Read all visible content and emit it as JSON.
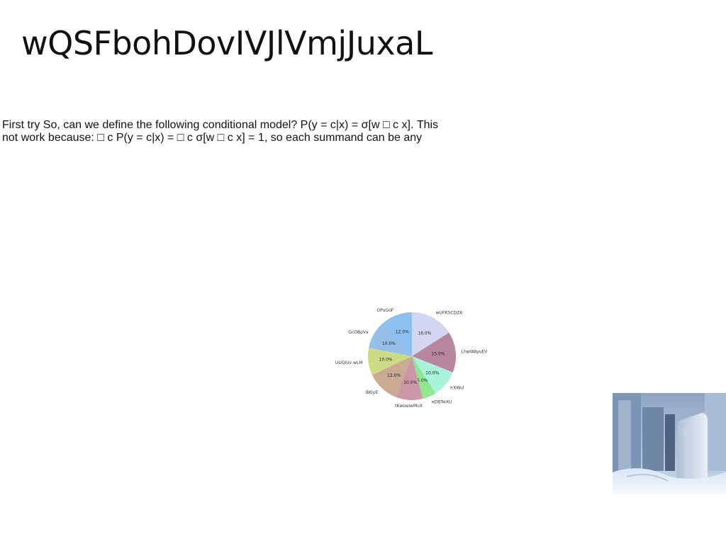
{
  "slide": {
    "title": "wQSFbohDovIVJlVmjJuxaL",
    "text_lines": [
      "First try So, can we define the following conditional model? P(y = c|x) = σ[w □ c x]. This",
      "not work because: □ c P(y = c|x) = □ c σ[w □ c x] = 1, so each summand can be any"
    ]
  },
  "photo": {
    "description_icon": "ice-landscape-image"
  },
  "chart_data": {
    "type": "pie",
    "title": "",
    "categories": [
      "wUFKSCDZA",
      "LhwWAyuEV",
      "IrXWul",
      "eDBTwXU",
      "tKwUeiwMuX",
      "BKIyE",
      "UUQIUv wLM",
      "GcOBpVx",
      "OPuGoF"
    ],
    "values": [
      16.0,
      15.0,
      10.0,
      5.0,
      10.0,
      12.0,
      10.0,
      10.0,
      12.0
    ],
    "labels": [
      "16.0%",
      "15.0%",
      "10.0%",
      "5.0%",
      "10.0%",
      "12.0%",
      "10.0%",
      "10.0%",
      "12.0%"
    ],
    "colors": [
      "#d3d6f0",
      "#b8869c",
      "#a9f2dc",
      "#8fe88f",
      "#cc98a8",
      "#c9ab93",
      "#ccdc84",
      "#95bee8",
      "#8cc0f0"
    ]
  }
}
